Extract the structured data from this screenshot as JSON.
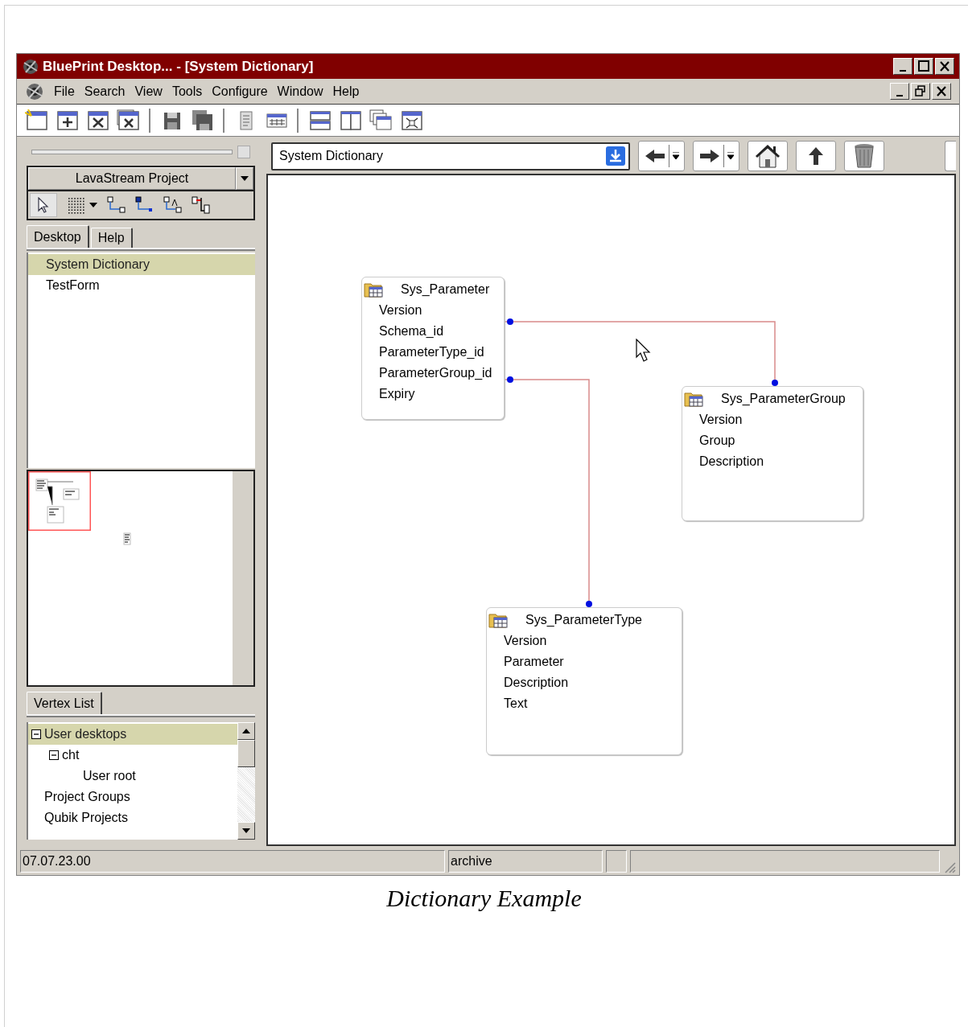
{
  "window": {
    "title": "BluePrint Desktop... - [System Dictionary]"
  },
  "menu": [
    "File",
    "Search",
    "View",
    "Tools",
    "Configure",
    "Window",
    "Help"
  ],
  "left_panel": {
    "project": "LavaStream Project",
    "tabs": [
      {
        "label": "Desktop",
        "selected": true
      },
      {
        "label": "Help",
        "selected": false
      }
    ],
    "desktop_items": [
      {
        "label": "System Dictionary",
        "selected": true
      },
      {
        "label": "TestForm",
        "selected": false
      }
    ],
    "vertex_tab": "Vertex List",
    "tree": [
      {
        "label": "User desktops",
        "selected": true,
        "expanded": true,
        "children": [
          {
            "label": "cht",
            "selected": false,
            "expanded": true,
            "children": [
              {
                "label": "User root",
                "selected": false
              }
            ]
          }
        ]
      },
      {
        "label": "Project Groups",
        "selected": false
      },
      {
        "label": "Qubik Projects",
        "selected": false
      }
    ]
  },
  "address": {
    "value": "System Dictionary"
  },
  "diagram": {
    "tables": [
      {
        "name": "Sys_Parameter",
        "fields": [
          "Version",
          "Schema_id",
          "ParameterType_id",
          "ParameterGroup_id",
          "Expiry"
        ]
      },
      {
        "name": "Sys_ParameterGroup",
        "fields": [
          "Version",
          "Group",
          "Description"
        ]
      },
      {
        "name": "Sys_ParameterType",
        "fields": [
          "Version",
          "Parameter",
          "Description",
          "Text"
        ]
      }
    ]
  },
  "status_bar": [
    "07.07.23.00",
    "archive"
  ],
  "caption": "Dictionary Example"
}
